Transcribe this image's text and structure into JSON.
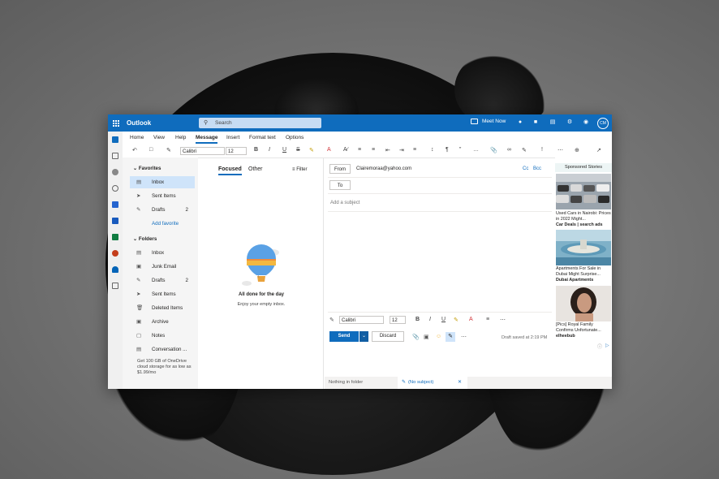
{
  "topbar": {
    "app_name": "Outlook",
    "search_placeholder": "Search",
    "meet_now": "Meet Now",
    "avatar_initials": "CM"
  },
  "menu": [
    "Home",
    "View",
    "Help",
    "Message",
    "Insert",
    "Format text",
    "Options"
  ],
  "active_menu": "Message",
  "ribbon": {
    "font": "Calibri",
    "size": "12"
  },
  "folders": {
    "favorites_label": "Favorites",
    "favorites": [
      {
        "label": "Inbox",
        "count": ""
      },
      {
        "label": "Sent Items",
        "count": ""
      },
      {
        "label": "Drafts",
        "count": "2"
      }
    ],
    "add_favorite": "Add favorite",
    "folders_label": "Folders",
    "items": [
      {
        "label": "Inbox",
        "count": ""
      },
      {
        "label": "Junk Email",
        "count": ""
      },
      {
        "label": "Drafts",
        "count": "2"
      },
      {
        "label": "Sent Items",
        "count": ""
      },
      {
        "label": "Deleted Items",
        "count": ""
      },
      {
        "label": "Archive",
        "count": ""
      },
      {
        "label": "Notes",
        "count": ""
      },
      {
        "label": "Conversation ...",
        "count": ""
      }
    ],
    "promo": "Get 100 GB of OneDrive cloud storage for as low as $1.99/mo"
  },
  "message_list": {
    "tab_focused": "Focused",
    "tab_other": "Other",
    "filter": "Filter",
    "empty_title": "All done for the day",
    "empty_subtitle": "Enjoy your empty inbox."
  },
  "compose": {
    "from_label": "From",
    "from_value": "Clairemoraa@yahoo.com",
    "cc": "Cc",
    "bcc": "Bcc",
    "to_label": "To",
    "subject_placeholder": "Add a subject",
    "font": "Calibri",
    "size": "12",
    "send": "Send",
    "discard": "Discard",
    "draft_status": "Draft saved at 2:19 PM"
  },
  "ads": {
    "header": "Sponsored Stories",
    "items": [
      {
        "title": "Used Cars in Nairobi: Prices in 2022 Might...",
        "source": "Car Deals | search ads"
      },
      {
        "title": "Apartments For Sale in Dubai Might Surprise...",
        "source": "Dubai Apartments"
      },
      {
        "title": "[Pics] Royal Family Confirms Unfortunate...",
        "source": "elheebub"
      }
    ]
  },
  "bottombar": {
    "status": "Nothing in folder",
    "draft_tab": "(No subject)"
  },
  "colors": {
    "brand": "#0f6cbd",
    "selection": "#cfe4fa"
  }
}
